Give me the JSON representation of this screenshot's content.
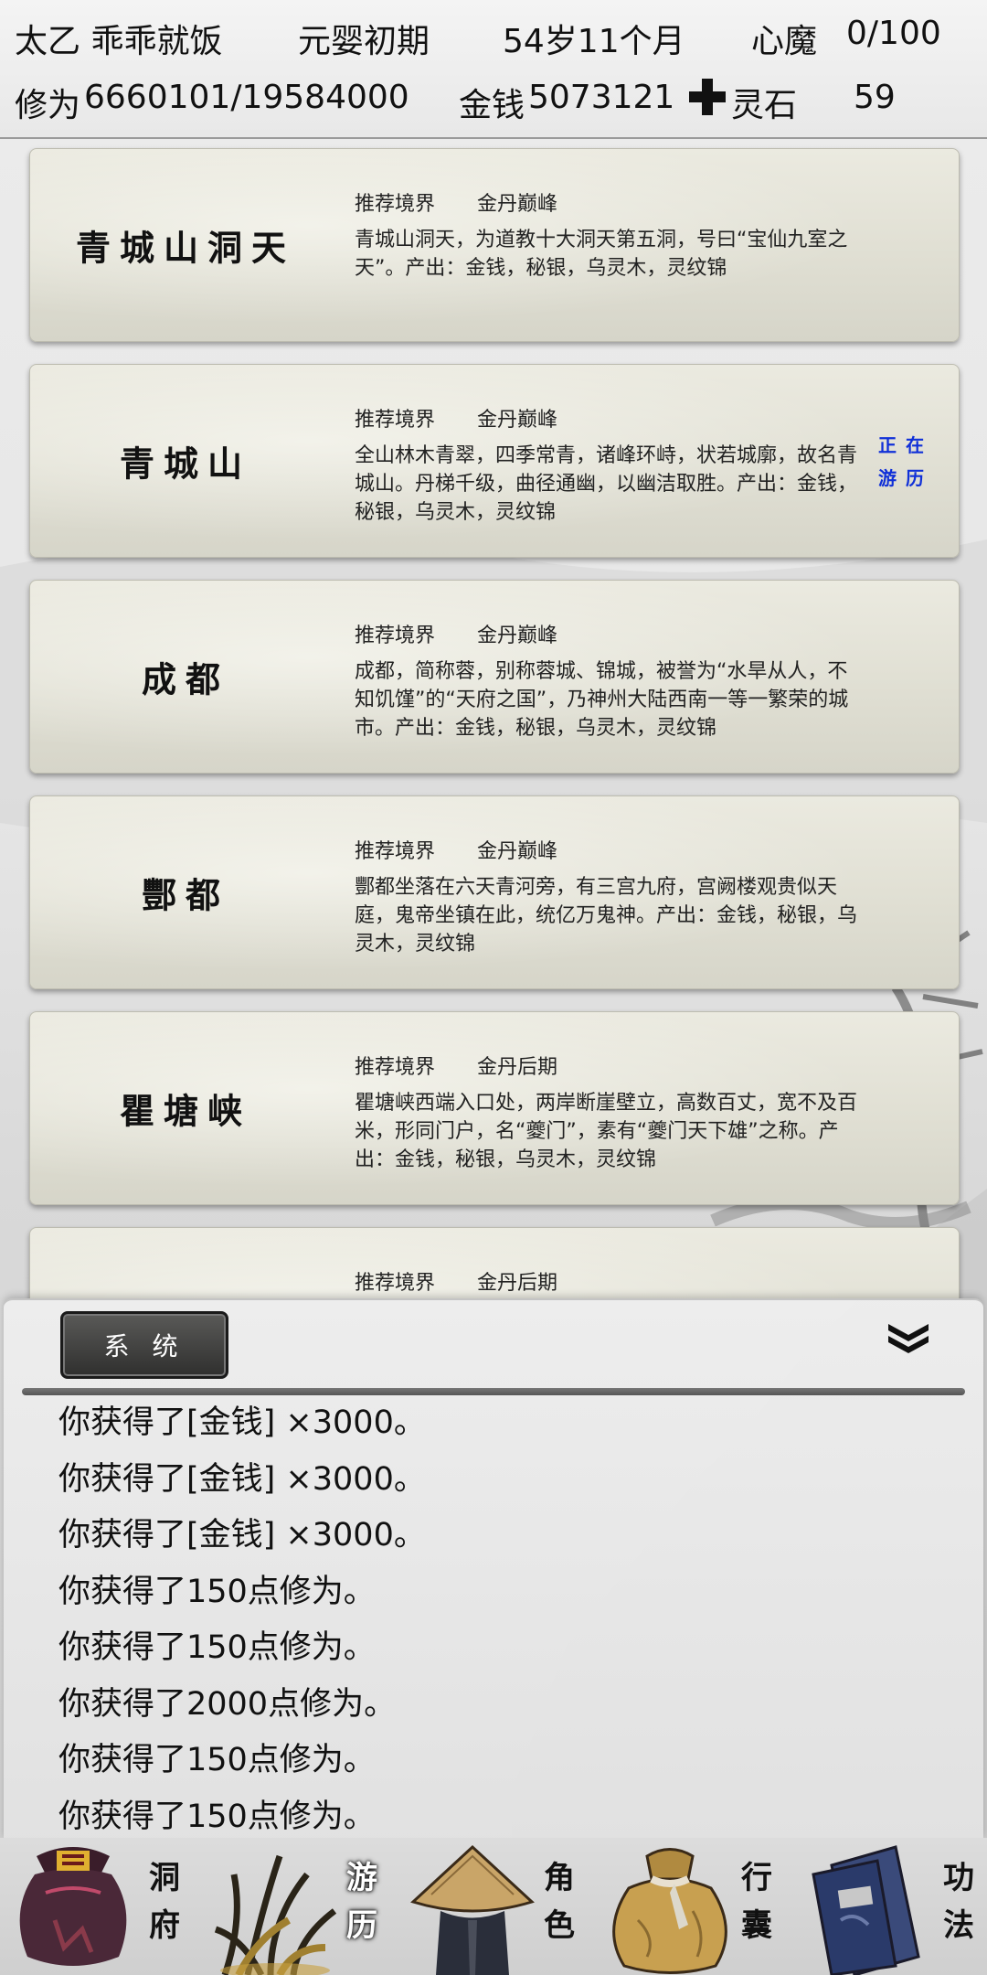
{
  "header": {
    "character_name": "太乙 乖乖就饭",
    "realm": "元婴初期",
    "age": "54岁11个月",
    "demon_label": "心魔",
    "demon_value": "0/100",
    "cultivation_label": "修为",
    "cultivation_value": "6660101/19584000",
    "money_label": "金钱",
    "money_value": "5073121",
    "stone_label": "灵石",
    "stone_value": "59",
    "stone_icon": "plus-cross-icon"
  },
  "locations": [
    {
      "name": "青城山洞天",
      "rec_label": "推荐境界",
      "rec_value": "金丹巅峰",
      "desc": "青城山洞天，为道教十大洞天第五洞，号曰“宝仙九室之天”。产出：金钱，秘银，乌灵木，灵纹锦",
      "status": ""
    },
    {
      "name": "青城山",
      "rec_label": "推荐境界",
      "rec_value": "金丹巅峰",
      "desc": "全山林木青翠，四季常青，诸峰环峙，状若城廓，故名青城山。丹梯千级，曲径通幽，以幽洁取胜。产出：金钱，秘银，乌灵木，灵纹锦",
      "status": "正在游历"
    },
    {
      "name": "成都",
      "rec_label": "推荐境界",
      "rec_value": "金丹巅峰",
      "desc": "成都，简称蓉，别称蓉城、锦城，被誉为“水旱从人，不知饥馑”的“天府之国”，乃神州大陆西南一等一繁荣的城市。产出：金钱，秘银，乌灵木，灵纹锦",
      "status": ""
    },
    {
      "name": "酆都",
      "rec_label": "推荐境界",
      "rec_value": "金丹巅峰",
      "desc": "酆都坐落在六天青河旁，有三宫九府，宫阙楼观贵似天庭，鬼帝坐镇在此，统亿万鬼神。产出：金钱，秘银，乌灵木，灵纹锦",
      "status": ""
    },
    {
      "name": "瞿塘峡",
      "rec_label": "推荐境界",
      "rec_value": "金丹后期",
      "desc": "瞿塘峡西端入口处，两岸断崖壁立，高数百丈，宽不及百米，形同门户，名“夔门”，素有“夔门天下雄”之称。产出：金钱，秘银，乌灵木，灵纹锦",
      "status": ""
    },
    {
      "name": "",
      "rec_label": "推荐境界",
      "rec_value": "金丹后期",
      "desc": "",
      "status": ""
    }
  ],
  "system": {
    "tab_label": "系 统",
    "collapse_icon": "double-chevron-down-icon",
    "messages": [
      "你获得了[金钱] ×3000。",
      "你获得了[金钱] ×3000。",
      "你获得了[金钱] ×3000。",
      "你获得了150点修为。",
      "你获得了150点修为。",
      "你获得了2000点修为。",
      "你获得了150点修为。",
      "你获得了150点修为。"
    ]
  },
  "nav": [
    {
      "label": "洞府",
      "icon": "money-bag-icon",
      "active": false
    },
    {
      "label": "游历",
      "icon": "grass-icon",
      "active": true
    },
    {
      "label": "角色",
      "icon": "straw-hat-icon",
      "active": false
    },
    {
      "label": "行囊",
      "icon": "sack-icon",
      "active": false
    },
    {
      "label": "功法",
      "icon": "books-icon",
      "active": false
    }
  ],
  "colors": {
    "status_blue": "#1030d8",
    "tab_dark": "#3a3a39",
    "divider": "#666666"
  }
}
